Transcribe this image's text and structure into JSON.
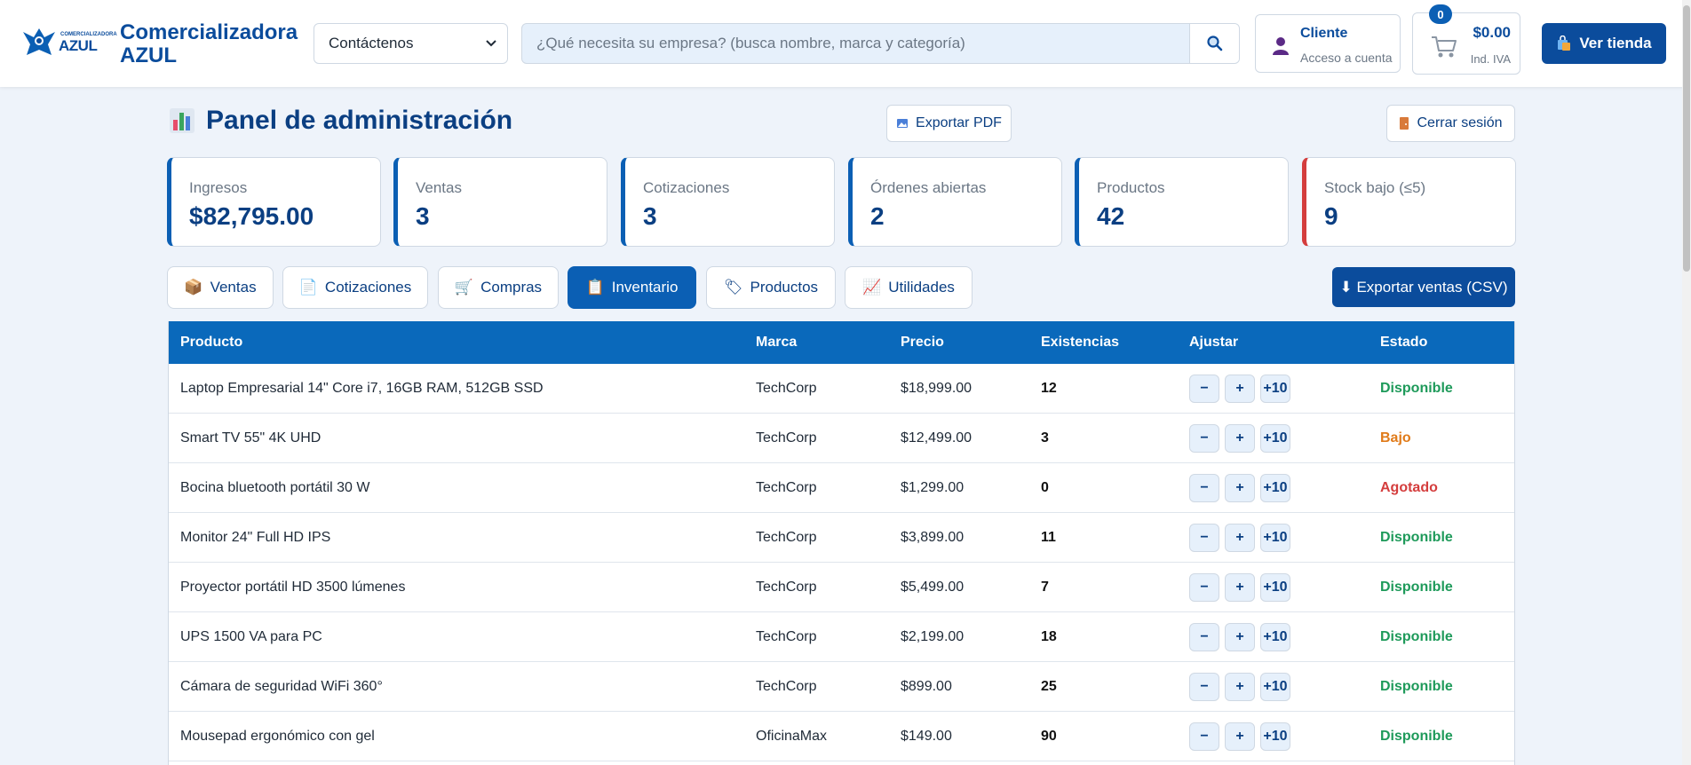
{
  "header": {
    "logo_small": "COMERCIALIZADORA",
    "logo_big": "AZUL",
    "brand_line1": "Comercializadora",
    "brand_line2": "AZUL",
    "contact_select": "Contáctenos",
    "search_placeholder": "¿Qué necesita su empresa? (busca nombre, marca y categoría)",
    "account_title": "Cliente",
    "account_subtitle": "Acceso a cuenta",
    "cart_count": "0",
    "cart_amount": "$0.00",
    "cart_tax": "Ind. IVA",
    "store_button": "Ver tienda",
    "icons": [
      "search-icon",
      "user-icon",
      "cart-icon",
      "shopping-bag-icon",
      "chevron-down-icon"
    ]
  },
  "panel": {
    "title": "Panel de administración",
    "export_pdf": "Exportar PDF",
    "logout": "Cerrar sesión"
  },
  "stats": [
    {
      "label": "Ingresos",
      "value": "$82,795.00"
    },
    {
      "label": "Ventas",
      "value": "3"
    },
    {
      "label": "Cotizaciones",
      "value": "3"
    },
    {
      "label": "Órdenes abiertas",
      "value": "2"
    },
    {
      "label": "Productos",
      "value": "42"
    },
    {
      "label": "Stock bajo (≤5)",
      "value": "9"
    }
  ],
  "tabs": [
    {
      "label": "Ventas",
      "icon": "📦"
    },
    {
      "label": "Cotizaciones",
      "icon": "📄"
    },
    {
      "label": "Compras",
      "icon": "🛒"
    },
    {
      "label": "Inventario",
      "icon": "📋"
    },
    {
      "label": "Productos",
      "icon": "🏷"
    },
    {
      "label": "Utilidades",
      "icon": "📈"
    }
  ],
  "active_tab": "Inventario",
  "export_csv": "⬇ Exportar ventas (CSV)",
  "table": {
    "headers": [
      "Producto",
      "Marca",
      "Precio",
      "Existencias",
      "Ajustar",
      "Estado"
    ],
    "adjust_buttons": [
      "−",
      "+",
      "+10"
    ],
    "rows": [
      {
        "product": "Laptop Empresarial 14\" Core i7, 16GB RAM, 512GB SSD",
        "brand": "TechCorp",
        "price": "$18,999.00",
        "stock": "12",
        "status": "Disponible"
      },
      {
        "product": "Smart TV 55\" 4K UHD",
        "brand": "TechCorp",
        "price": "$12,499.00",
        "stock": "3",
        "status": "Bajo"
      },
      {
        "product": "Bocina bluetooth portátil 30 W",
        "brand": "TechCorp",
        "price": "$1,299.00",
        "stock": "0",
        "status": "Agotado"
      },
      {
        "product": "Monitor 24\" Full HD IPS",
        "brand": "TechCorp",
        "price": "$3,899.00",
        "stock": "11",
        "status": "Disponible"
      },
      {
        "product": "Proyector portátil HD 3500 lúmenes",
        "brand": "TechCorp",
        "price": "$5,499.00",
        "stock": "7",
        "status": "Disponible"
      },
      {
        "product": "UPS 1500 VA para PC",
        "brand": "TechCorp",
        "price": "$2,199.00",
        "stock": "18",
        "status": "Disponible"
      },
      {
        "product": "Cámara de seguridad WiFi 360°",
        "brand": "TechCorp",
        "price": "$899.00",
        "stock": "25",
        "status": "Disponible"
      },
      {
        "product": "Mousepad ergonómico con gel",
        "brand": "OficinaMax",
        "price": "$149.00",
        "stock": "90",
        "status": "Disponible"
      }
    ]
  },
  "status_colors": {
    "Disponible": "#1e9a5a",
    "Bajo": "#e07b1a",
    "Agotado": "#d43d3d"
  }
}
